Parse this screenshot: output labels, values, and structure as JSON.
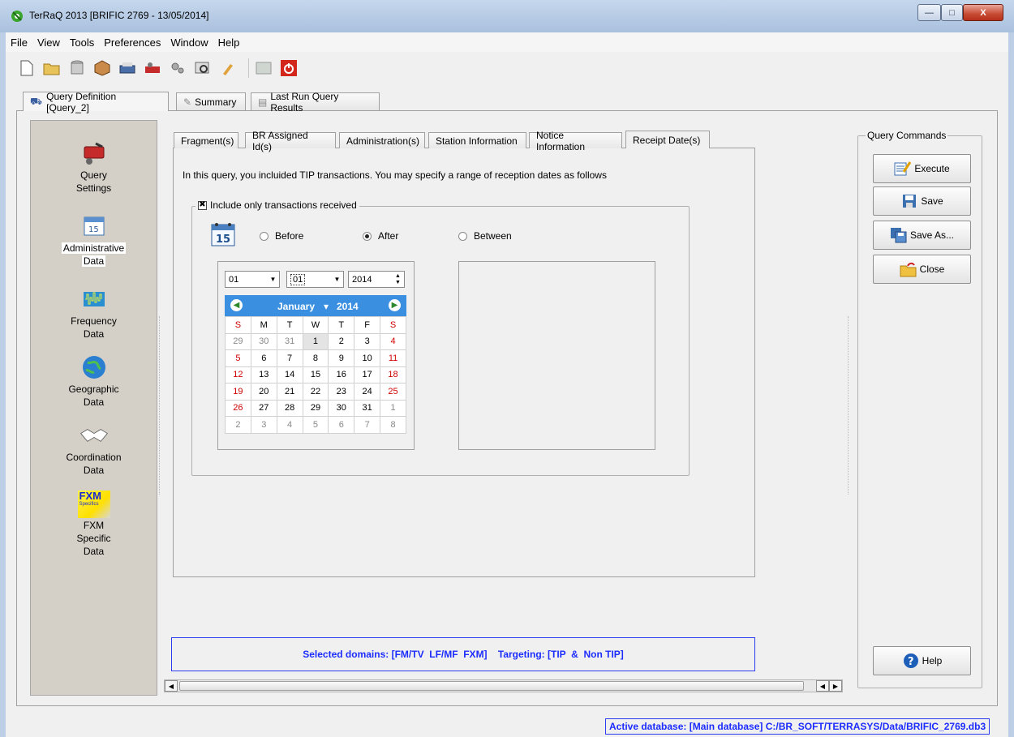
{
  "window": {
    "title": "TerRaQ 2013 [BRIFIC 2769 - 13/05/2014]",
    "controls": {
      "minimize": "—",
      "maximize": "□",
      "close": "X"
    }
  },
  "menubar": [
    "File",
    "View",
    "Tools",
    "Preferences",
    "Window",
    "Help"
  ],
  "toolbar": {
    "icons": [
      "new-document-icon",
      "open-folder-icon",
      "database-icon",
      "package-icon",
      "printer-icon",
      "tools-icon",
      "settings-icon",
      "search-icon",
      "brush-icon",
      "disabled-icon",
      "power-icon"
    ]
  },
  "top_tabs": [
    {
      "label": "Query Definition [Query_2]",
      "icon": "query-icon",
      "active": true
    },
    {
      "label": "Summary",
      "icon": "summary-icon",
      "active": false
    },
    {
      "label": "Last Run Query Results",
      "icon": "results-icon",
      "active": false
    }
  ],
  "left_nav": [
    {
      "label1": "Query",
      "label2": "Settings",
      "icon": "query-settings-icon"
    },
    {
      "label1": "Administrative",
      "label2": "Data",
      "icon": "calendar-icon",
      "active": true
    },
    {
      "label1": "Frequency",
      "label2": "Data",
      "icon": "frequency-icon"
    },
    {
      "label1": "Geographic",
      "label2": "Data",
      "icon": "globe-icon"
    },
    {
      "label1": "Coordination",
      "label2": "Data",
      "icon": "handshake-icon"
    },
    {
      "label1": "FXM",
      "label2": "Specific",
      "label3": "Data",
      "icon": "fxm-icon",
      "icon_text": "FXM",
      "icon_subtext": "Specifics"
    }
  ],
  "inner_tabs": [
    "Fragment(s)",
    "BR Assigned Id(s)",
    "Administration(s)",
    "Station Information",
    "Notice Information",
    "Receipt Date(s)"
  ],
  "info_text": "In this query, you incluided TIP transactions. You may specify a range of reception dates as follows",
  "group": {
    "title": "Include only transactions received",
    "checked": true,
    "radios": [
      {
        "label": "Before",
        "selected": false
      },
      {
        "label": "After",
        "selected": true
      },
      {
        "label": "Between",
        "selected": false
      }
    ],
    "calendar_icon_text": "15"
  },
  "calendar": {
    "month_combo": "01",
    "day_combo": "01",
    "year_spin": "2014",
    "header_month": "January",
    "header_year": "2014",
    "weekdays": [
      "S",
      "M",
      "T",
      "W",
      "T",
      "F",
      "S"
    ],
    "weeks": [
      [
        "29",
        "30",
        "31",
        "1",
        "2",
        "3",
        "4"
      ],
      [
        "5",
        "6",
        "7",
        "8",
        "9",
        "10",
        "11"
      ],
      [
        "12",
        "13",
        "14",
        "15",
        "16",
        "17",
        "18"
      ],
      [
        "19",
        "20",
        "21",
        "22",
        "23",
        "24",
        "25"
      ],
      [
        "26",
        "27",
        "28",
        "29",
        "30",
        "31",
        "1"
      ],
      [
        "2",
        "3",
        "4",
        "5",
        "6",
        "7",
        "8"
      ]
    ],
    "selected_day": "1"
  },
  "query_commands": {
    "title": "Query Commands",
    "buttons": [
      {
        "label": "Execute",
        "icon": "execute-icon"
      },
      {
        "label": "Save",
        "icon": "save-icon"
      },
      {
        "label": "Save As...",
        "icon": "save-as-icon"
      },
      {
        "label": "Close",
        "icon": "close-folder-icon"
      }
    ],
    "help": "Help"
  },
  "domain_text": "Selected domains: [FM/TV  LF/MF  FXM]    Targeting: [TIP  &  Non TIP]",
  "status": "Active database: [Main database] C:/BR_SOFT/TERRASYS/Data/BRIFIC_2769.db3",
  "colors": {
    "calendar_header": "#3a8fe0",
    "weekend_text": "#d00000",
    "domain_text": "#1c2cff",
    "left_nav_bg": "#d4d0c8"
  }
}
